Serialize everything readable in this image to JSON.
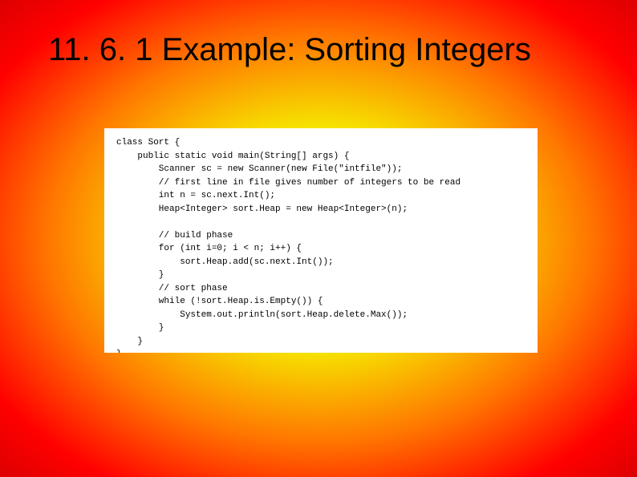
{
  "slide": {
    "title": "11. 6. 1 Example: Sorting Integers"
  },
  "code": {
    "line1": "class Sort {",
    "line2": "    public static void main(String[] args) {",
    "line3": "        Scanner sc = new Scanner(new File(\"intfile\"));",
    "line4": "        // first line in file gives number of integers to be read",
    "line5": "        int n = sc.next.Int();",
    "line6": "        Heap<Integer> sort.Heap = new Heap<Integer>(n);",
    "line7": "",
    "line8": "        // build phase",
    "line9": "        for (int i=0; i < n; i++) {",
    "line10": "            sort.Heap.add(sc.next.Int());",
    "line11": "        }",
    "line12": "        // sort phase",
    "line13": "        while (!sort.Heap.is.Empty()) {",
    "line14": "            System.out.println(sort.Heap.delete.Max());",
    "line15": "        }",
    "line16": "    }",
    "line17": "}"
  }
}
